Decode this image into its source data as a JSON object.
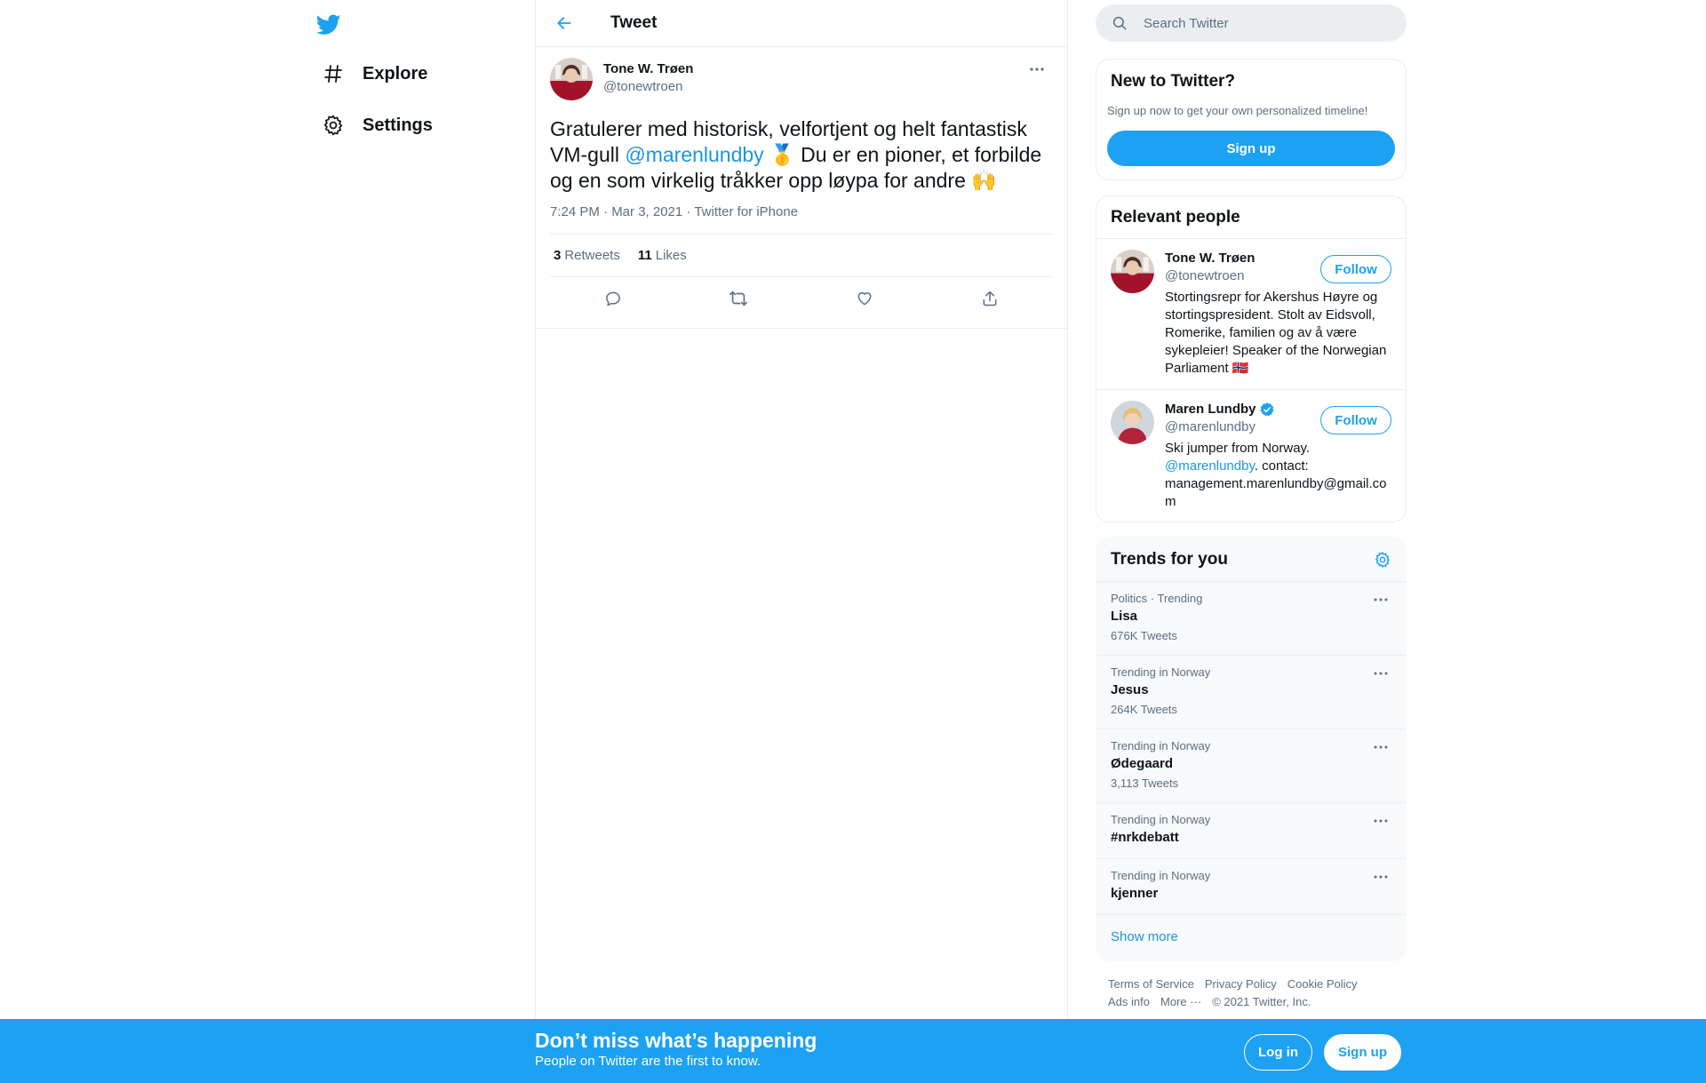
{
  "nav": {
    "logo_icon": "twitter-bird-icon",
    "items": [
      {
        "label": "Explore",
        "icon": "hashtag-icon"
      },
      {
        "label": "Settings",
        "icon": "gear-icon"
      }
    ]
  },
  "header": {
    "title": "Tweet"
  },
  "tweet": {
    "author_name": "Tone W. Trøen",
    "author_handle": "@tonewtroen",
    "text_part1": "Gratulerer med historisk, velfortjent og helt fantastisk VM-gull ",
    "mention": "@marenlundby",
    "text_part2": " 🥇 Du er en pioner, et forbilde og en som virkelig tråkker opp løypa for andre 🙌",
    "time": "7:24 PM · Mar 3, 2021",
    "separator": " · ",
    "source": "Twitter for iPhone",
    "retweets_count": "3",
    "retweets_label": "Retweets",
    "likes_count": "11",
    "likes_label": "Likes"
  },
  "search": {
    "placeholder": "Search Twitter"
  },
  "new_to_twitter": {
    "title": "New to Twitter?",
    "subtitle": "Sign up now to get your own personalized timeline!",
    "button": "Sign up"
  },
  "relevant_people": {
    "title": "Relevant people",
    "people": [
      {
        "name": "Tone W. Trøen",
        "handle": "@tonewtroen",
        "bio": "Stortingsrepr for Akershus Høyre og stortingspresident. Stolt av Eidsvoll, Romerike, familien og av å være sykepleier! Speaker of the Norwegian Parliament 🇳🇴",
        "button": "Follow",
        "verified": false
      },
      {
        "name": "Maren Lundby",
        "handle": "@marenlundby",
        "bio_part1": "Ski jumper from Norway. ",
        "bio_mention": "@marenlundby",
        "bio_part2": ". contact: management.marenlundby@gmail.com",
        "button": "Follow",
        "verified": true
      }
    ]
  },
  "trends": {
    "title": "Trends for you",
    "items": [
      {
        "context": "Politics · Trending",
        "name": "Lisa",
        "count": "676K Tweets"
      },
      {
        "context": "Trending in Norway",
        "name": "Jesus",
        "count": "264K Tweets"
      },
      {
        "context": "Trending in Norway",
        "name": "Ødegaard",
        "count": "3,113 Tweets"
      },
      {
        "context": "Trending in Norway",
        "name": "#nrkdebatt",
        "count": ""
      },
      {
        "context": "Trending in Norway",
        "name": "kjenner",
        "count": ""
      }
    ],
    "show_more": "Show more"
  },
  "footer": {
    "links": [
      "Terms of Service",
      "Privacy Policy",
      "Cookie Policy",
      "Ads info",
      "More ···"
    ],
    "copyright": "© 2021 Twitter, Inc."
  },
  "banner": {
    "title": "Don’t miss what’s happening",
    "subtitle": "People on Twitter are the first to know.",
    "login": "Log in",
    "signup": "Sign up"
  },
  "colors": {
    "accent": "#1da1f2",
    "link": "#1b95e0",
    "muted": "#5b7083",
    "text": "#0f1419"
  }
}
